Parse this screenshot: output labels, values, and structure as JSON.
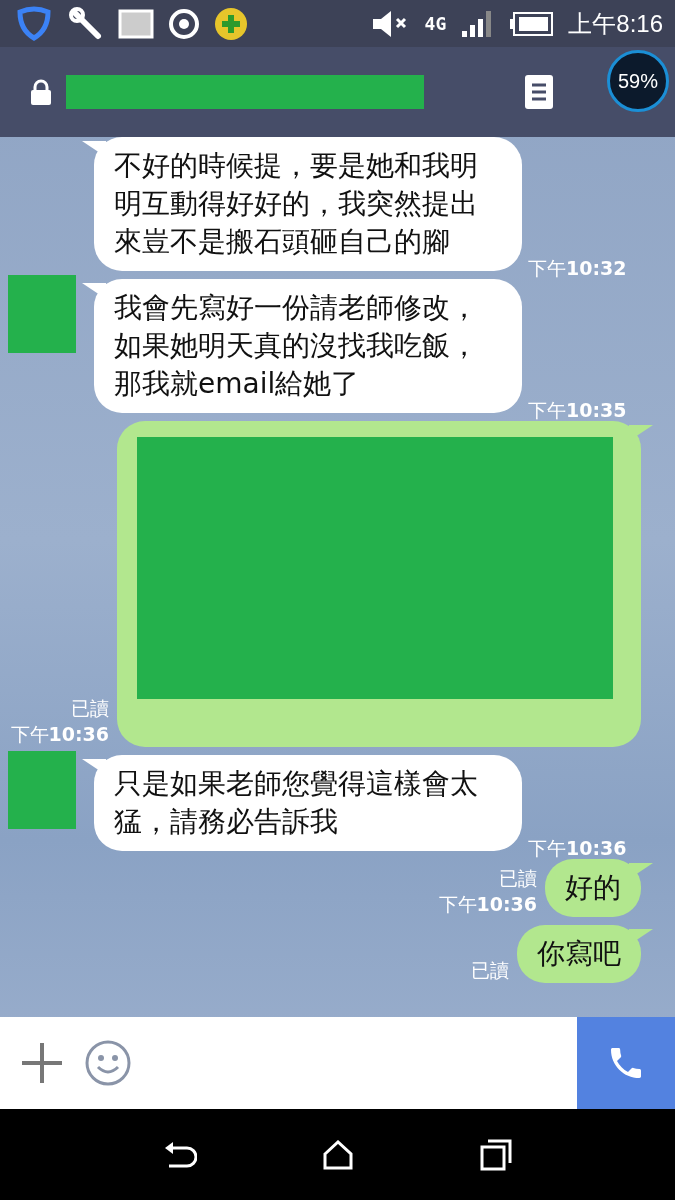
{
  "status_bar": {
    "network": "4G",
    "time": "上午8:16"
  },
  "overlay_badge": {
    "text": "59%"
  },
  "messages": [
    {
      "kind": "incoming",
      "avatar": false,
      "text": "不好的時候提，要是她和我明明互動得好好的，我突然提出來豈不是搬石頭砸自己的腳",
      "time": "下午**10:32**"
    },
    {
      "kind": "incoming",
      "avatar": true,
      "text": "我會先寫好一份請老師修改，如果她明天真的沒找我吃飯，那我就email給她了",
      "time": "下午**10:35**"
    },
    {
      "kind": "outgoing_redacted",
      "read": "已讀",
      "time": "下午**10:36**"
    },
    {
      "kind": "incoming",
      "avatar": true,
      "text": "只是如果老師您覺得這樣會太猛，請務必告訴我",
      "time": "下午**10:36**"
    },
    {
      "kind": "outgoing",
      "text": "好的",
      "read": "已讀",
      "time": "下午**10:36**"
    },
    {
      "kind": "outgoing",
      "text": "你寫吧",
      "read": "已讀"
    }
  ]
}
